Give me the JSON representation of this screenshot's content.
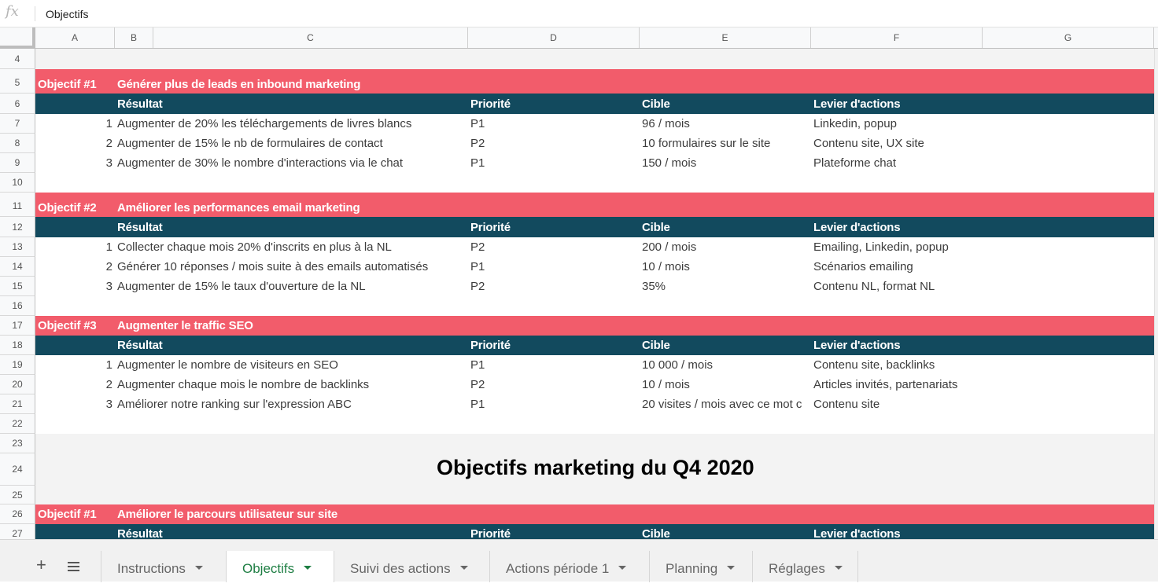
{
  "formula_bar": {
    "fx": "fx",
    "value": "Objectifs"
  },
  "columns": [
    "A",
    "B",
    "C",
    "D",
    "E",
    "F",
    "G"
  ],
  "rows": {
    "r4": "4",
    "r5": "5",
    "r6": "6",
    "r7": "7",
    "r8": "8",
    "r9": "9",
    "r10": "10",
    "r11": "11",
    "r12": "12",
    "r13": "13",
    "r14": "14",
    "r15": "15",
    "r16": "16",
    "r17": "17",
    "r18": "18",
    "r19": "19",
    "r20": "20",
    "r21": "21",
    "r22": "22",
    "r23": "23",
    "r24": "24",
    "r25": "25",
    "r26": "26",
    "r27": "27"
  },
  "headers": {
    "resultat": "Résultat",
    "priorite": "Priorité",
    "cible": "Cible",
    "levier": "Levier d'actions"
  },
  "objectives": [
    {
      "label": "Objectif #1",
      "title": "Générer plus de leads en inbound marketing",
      "items": [
        {
          "n": "1",
          "result": "Augmenter de 20% les téléchargements de livres blancs",
          "priority": "P1",
          "target": "96 / mois",
          "lever": "Linkedin, popup"
        },
        {
          "n": "2",
          "result": "Augmenter de 15% le nb de formulaires de contact",
          "priority": "P2",
          "target": "10 formulaires sur le site",
          "lever": "Contenu site, UX site"
        },
        {
          "n": "3",
          "result": "Augmenter de 30% le nombre d'interactions via le chat",
          "priority": "P1",
          "target": "150 / mois",
          "lever": "Plateforme chat"
        }
      ]
    },
    {
      "label": "Objectif #2",
      "title": "Améliorer les performances email marketing",
      "items": [
        {
          "n": "1",
          "result": "Collecter chaque mois 20% d'inscrits en plus à la NL",
          "priority": "P2",
          "target": "200 / mois",
          "lever": "Emailing, Linkedin, popup"
        },
        {
          "n": "2",
          "result": "Générer 10 réponses / mois suite à des emails automatisés",
          "priority": "P1",
          "target": "10 / mois",
          "lever": "Scénarios emailing"
        },
        {
          "n": "3",
          "result": "Augmenter de 15% le taux d'ouverture de la NL",
          "priority": "P2",
          "target": "35%",
          "lever": "Contenu NL, format NL"
        }
      ]
    },
    {
      "label": "Objectif #3",
      "title": "Augmenter le traffic SEO",
      "items": [
        {
          "n": "1",
          "result": "Augmenter le nombre de visiteurs en SEO",
          "priority": "P1",
          "target": "10 000 / mois",
          "lever": "Contenu site, backlinks"
        },
        {
          "n": "2",
          "result": "Augmenter chaque mois le nombre de backlinks",
          "priority": "P2",
          "target": "10 / mois",
          "lever": "Articles invités, partenariats"
        },
        {
          "n": "3",
          "result": "Améliorer notre ranking sur l'expression ABC",
          "priority": "P1",
          "target": "20 visites / mois avec ce mot c",
          "lever": "Contenu site"
        }
      ]
    }
  ],
  "q4": {
    "title": "Objectifs marketing du Q4 2020",
    "objective_label": "Objectif #1",
    "objective_title": "Améliorer le parcours utilisateur sur site"
  },
  "tabs": [
    {
      "label": "Instructions"
    },
    {
      "label": "Objectifs"
    },
    {
      "label": "Suivi des actions"
    },
    {
      "label": "Actions période 1"
    },
    {
      "label": "Planning"
    },
    {
      "label": "Réglages"
    }
  ],
  "colors": {
    "objective_red": "#f25c6b",
    "header_teal": "#124a5e",
    "active_tab_green": "#1e7e43"
  }
}
